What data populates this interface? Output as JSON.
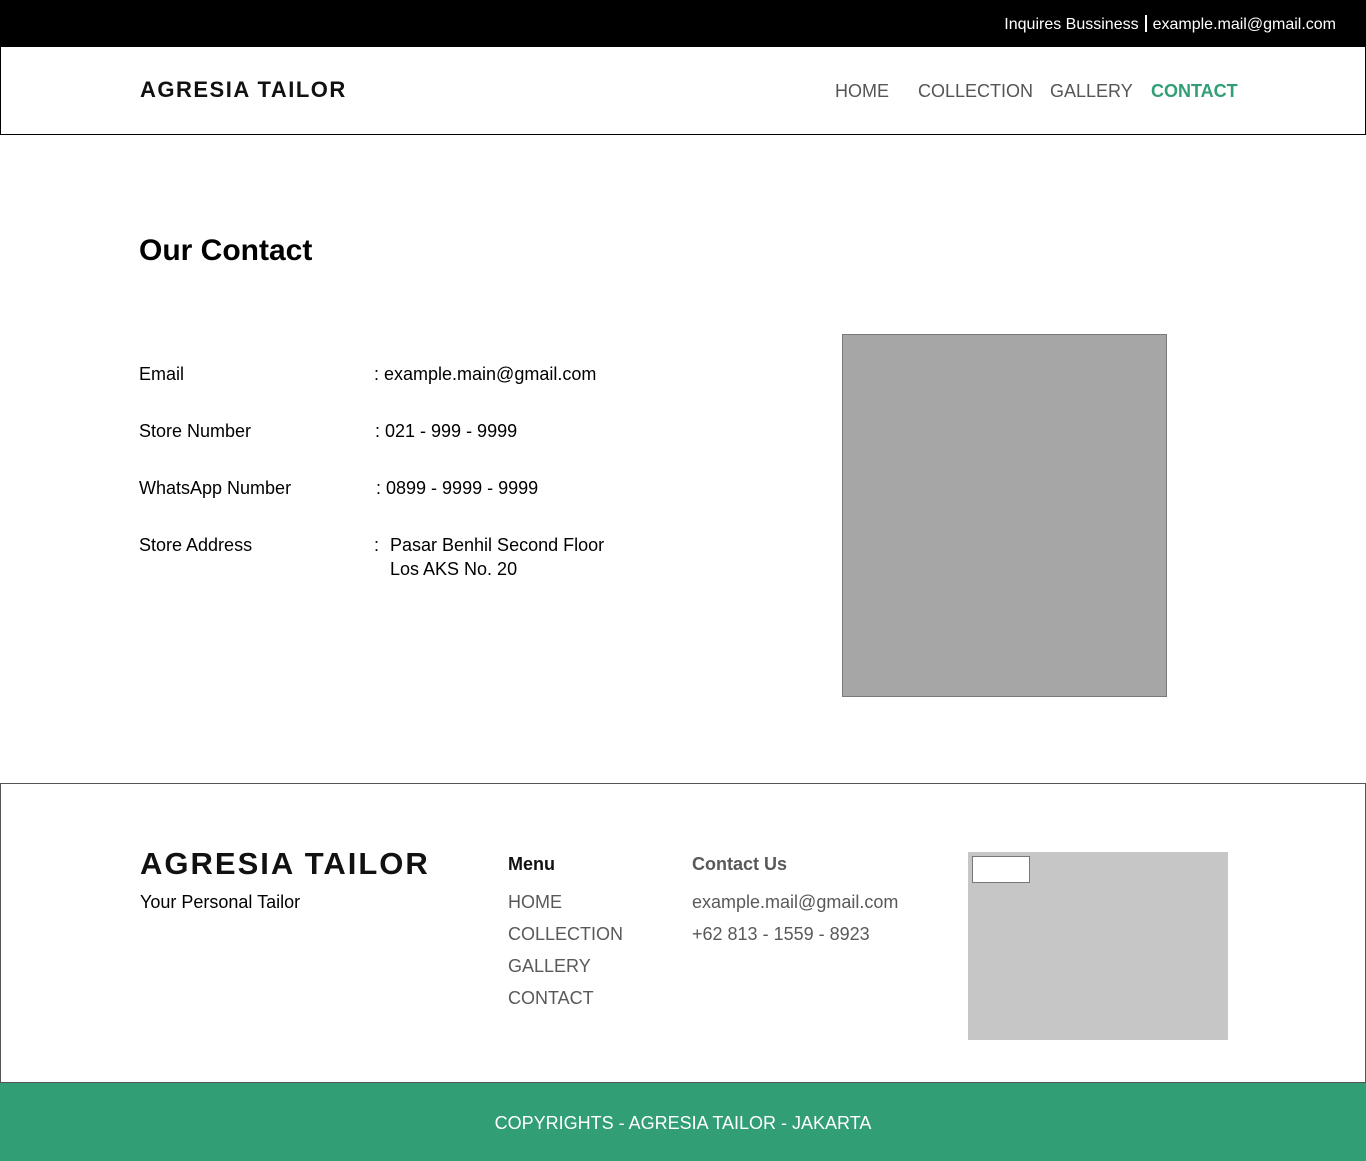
{
  "topbar": {
    "inquires_label": "Inquires Bussiness",
    "email": "example.mail@gmail.com"
  },
  "header": {
    "logo": "AGRESIA TAILOR",
    "nav": {
      "home": "HOME",
      "collection": "COLLECTION",
      "gallery": "GALLERY",
      "contact": "CONTACT"
    },
    "active_color": "#319e75"
  },
  "main": {
    "title": "Our Contact",
    "rows": {
      "email": {
        "label": "Email",
        "value": ": example.main@gmail.com"
      },
      "store_number": {
        "label": "Store Number",
        "value": ": 021 - 999 - 9999"
      },
      "whatsapp": {
        "label": "WhatsApp Number",
        "value": ": 0899 - 9999 - 9999"
      },
      "address": {
        "label": "Store Address",
        "colon": ":",
        "line1": "Pasar Benhil Second Floor",
        "line2": "Los AKS No. 20"
      }
    }
  },
  "footer": {
    "logo": "AGRESIA TAILOR",
    "tagline": "Your Personal Tailor",
    "menu_heading": "Menu",
    "menu": {
      "home": "HOME",
      "collection": "COLLECTION",
      "gallery": "GALLERY",
      "contact": "CONTACT"
    },
    "contact_heading": "Contact Us",
    "contact_email": "example.mail@gmail.com",
    "contact_phone": "+62 813 - 1559 - 8923"
  },
  "bottombar": {
    "copyright": "COPYRIGHTS - AGRESIA TAILOR - JAKARTA",
    "color": "#319e75"
  }
}
